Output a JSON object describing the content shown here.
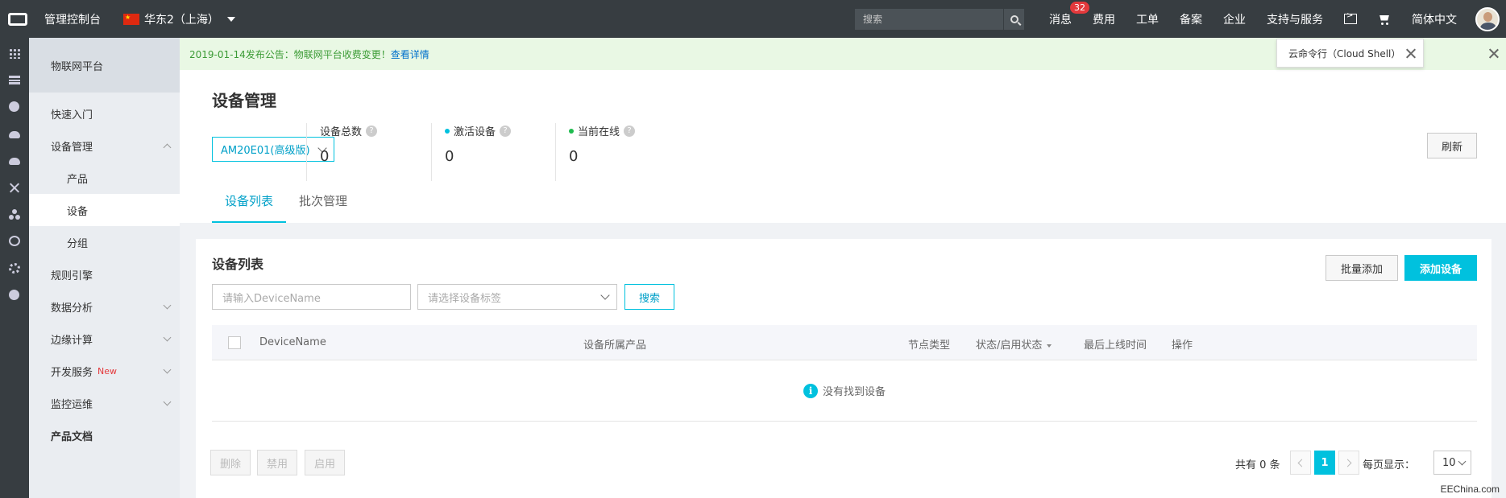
{
  "topbar": {
    "console_title": "管理控制台",
    "region": "华东2（上海）",
    "search_placeholder": "搜索",
    "nav": {
      "messages": "消息",
      "messages_badge": "32",
      "billing": "费用",
      "tickets": "工单",
      "icp": "备案",
      "enterprise": "企业",
      "support": "支持与服务",
      "language": "简体中文"
    }
  },
  "rail": {
    "icons": [
      "grid-icon",
      "database-icon",
      "brain-icon",
      "cloud-icon",
      "cloud-upload-icon",
      "network-icon",
      "cluster-icon",
      "globe-icon",
      "gear-icon",
      "circle-icon"
    ]
  },
  "sidebar": {
    "header": "物联网平台",
    "items": [
      {
        "label": "快速入门"
      },
      {
        "label": "设备管理"
      },
      {
        "label": "产品"
      },
      {
        "label": "设备"
      },
      {
        "label": "分组"
      },
      {
        "label": "规则引擎"
      },
      {
        "label": "数据分析"
      },
      {
        "label": "边缘计算"
      },
      {
        "label": "开发服务",
        "tag": "New"
      },
      {
        "label": "监控运维"
      },
      {
        "label": "产品文档"
      }
    ]
  },
  "notice": {
    "text": "2019-01-14发布公告：物联网平台收费变更！",
    "link": "查看详情"
  },
  "tooltip": {
    "text": "云命令行（Cloud Shell）"
  },
  "header": {
    "title": "设备管理",
    "product_select": "AM20E01(高级版)",
    "stats": [
      {
        "label": "设备总数",
        "value": "0"
      },
      {
        "label": "激活设备",
        "value": "0",
        "color": "#00c1de"
      },
      {
        "label": "当前在线",
        "value": "0",
        "color": "#1ebb4e"
      }
    ],
    "refresh": "刷新",
    "tabs": [
      "设备列表",
      "批次管理"
    ]
  },
  "card": {
    "title": "设备列表",
    "batch_add": "批量添加",
    "add_device": "添加设备",
    "name_placeholder": "请输入DeviceName",
    "tag_placeholder": "请选择设备标签",
    "search": "搜索",
    "columns": [
      "DeviceName",
      "设备所属产品",
      "节点类型",
      "状态/启用状态",
      "最后上线时间",
      "操作"
    ],
    "empty": "没有找到设备",
    "actions": [
      "删除",
      "禁用",
      "启用"
    ],
    "pager": {
      "total": "共有 0 条",
      "current": "1",
      "per_page_label": "每页显示：",
      "per_page": "10"
    }
  },
  "watermark": "EEChina.com"
}
